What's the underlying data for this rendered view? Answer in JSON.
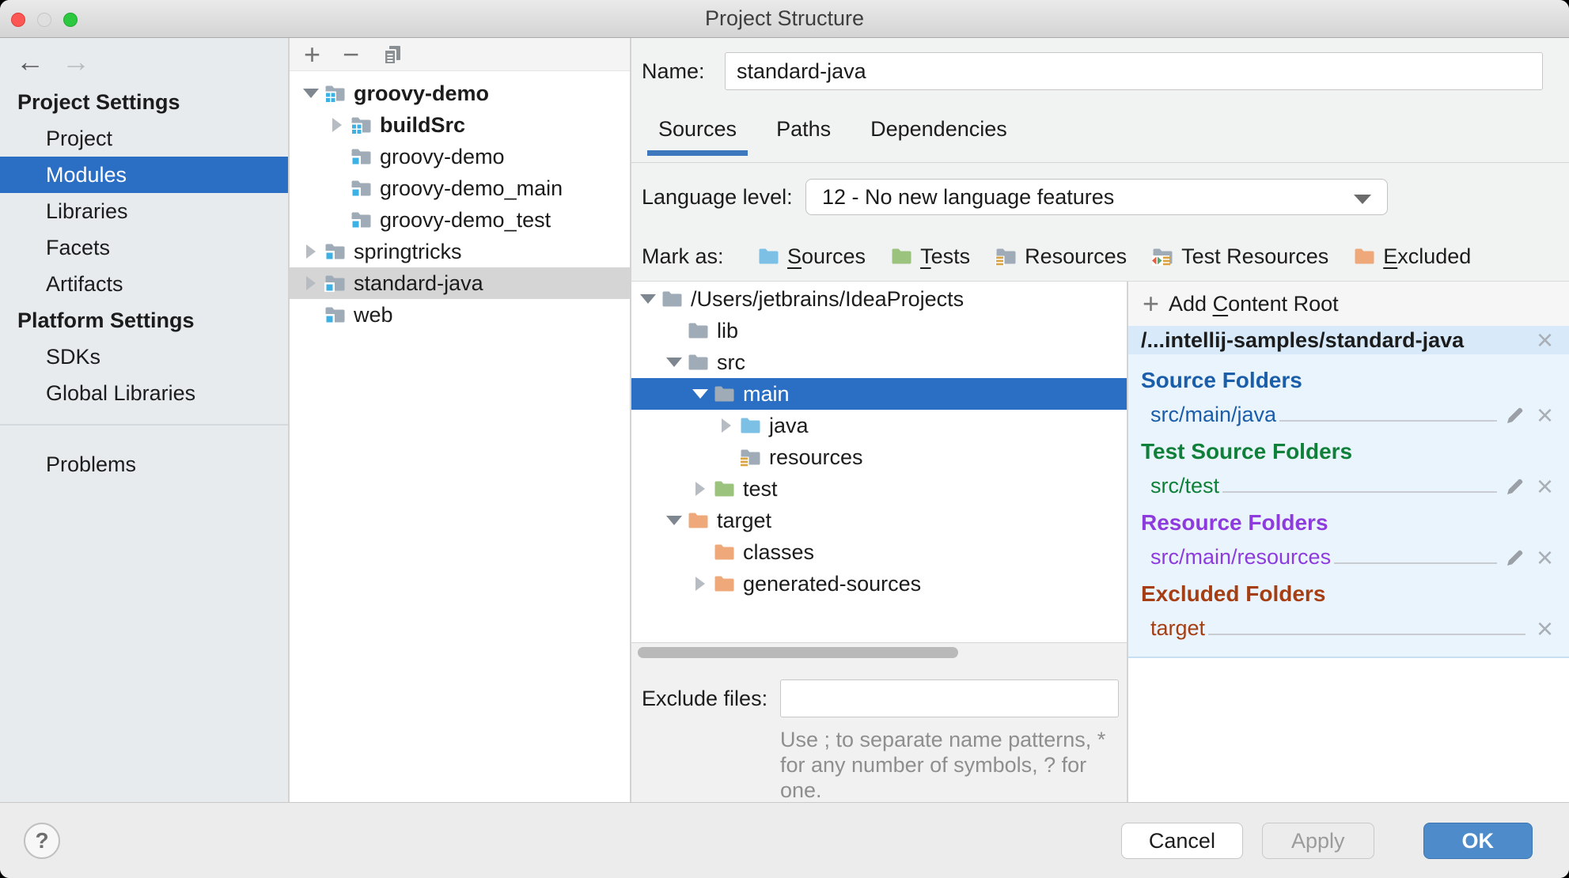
{
  "window": {
    "title": "Project Structure"
  },
  "sidebar": {
    "back": "←",
    "forward": "→",
    "items": [
      {
        "label": "Project Settings",
        "classes": [
          "header"
        ]
      },
      {
        "label": "Project",
        "classes": []
      },
      {
        "label": "Modules",
        "classes": [
          "selected"
        ]
      },
      {
        "label": "Libraries",
        "classes": []
      },
      {
        "label": "Facets",
        "classes": []
      },
      {
        "label": "Artifacts",
        "classes": []
      },
      {
        "label": "Platform Settings",
        "classes": [
          "header"
        ]
      },
      {
        "label": "SDKs",
        "classes": []
      },
      {
        "label": "Global Libraries",
        "classes": []
      },
      {
        "label": "",
        "classes": [
          "divider"
        ]
      },
      {
        "label": "Problems",
        "classes": []
      }
    ]
  },
  "modulesPanel": {
    "toolbar": {
      "add": "+",
      "remove": "−",
      "copy_icon": "copy"
    },
    "tree": [
      {
        "label": "groovy-demo",
        "depth": 0,
        "arrow": "down",
        "icon": "module-project",
        "classes": [
          "bold"
        ]
      },
      {
        "label": "buildSrc",
        "depth": 1,
        "arrow": "right",
        "icon": "module-project",
        "classes": [
          "bold"
        ]
      },
      {
        "label": "groovy-demo",
        "depth": 1,
        "arrow": "none",
        "icon": "module",
        "classes": []
      },
      {
        "label": "groovy-demo_main",
        "depth": 1,
        "arrow": "none",
        "icon": "module",
        "classes": []
      },
      {
        "label": "groovy-demo_test",
        "depth": 1,
        "arrow": "none",
        "icon": "module",
        "classes": []
      },
      {
        "label": "springtricks",
        "depth": 0,
        "arrow": "right",
        "icon": "module",
        "classes": []
      },
      {
        "label": "standard-java",
        "depth": 0,
        "arrow": "right",
        "icon": "module",
        "classes": [
          "selected-inactive"
        ]
      },
      {
        "label": "web",
        "depth": 0,
        "arrow": "none",
        "icon": "module",
        "classes": []
      }
    ]
  },
  "details": {
    "name_label": "Name:",
    "name_value": "standard-java",
    "tabs": [
      {
        "label": "Sources",
        "classes": [
          "active"
        ]
      },
      {
        "label": "Paths",
        "classes": []
      },
      {
        "label": "Dependencies",
        "classes": []
      }
    ],
    "language_level_label": "Language level:",
    "language_level_value": "12 - No new language features",
    "mark_as_label": "Mark as:",
    "mark_as": [
      {
        "pre": "",
        "mn": "S",
        "post": "ources",
        "icon": "folder-blue"
      },
      {
        "pre": "",
        "mn": "T",
        "post": "ests",
        "icon": "folder-green"
      },
      {
        "pre": "Resources",
        "mn": "",
        "post": "",
        "icon": "folder-resources"
      },
      {
        "pre": "Test Resources",
        "mn": "",
        "post": "",
        "icon": "folder-test-resources"
      },
      {
        "pre": "",
        "mn": "E",
        "post": "xcluded",
        "icon": "folder-orange"
      }
    ]
  },
  "fileTree": {
    "rows": [
      {
        "label": "/Users/jetbrains/IdeaProjects",
        "depth": 0,
        "arrow": "down",
        "icon": "folder-gray",
        "classes": []
      },
      {
        "label": "lib",
        "depth": 1,
        "arrow": "none",
        "icon": "folder-gray",
        "classes": []
      },
      {
        "label": "src",
        "depth": 1,
        "arrow": "down",
        "icon": "folder-gray",
        "classes": []
      },
      {
        "label": "main",
        "depth": 2,
        "arrow": "down",
        "icon": "folder-gray",
        "classes": [
          "selected"
        ]
      },
      {
        "label": "java",
        "depth": 3,
        "arrow": "right",
        "icon": "folder-blue",
        "classes": []
      },
      {
        "label": "resources",
        "depth": 3,
        "arrow": "none",
        "icon": "folder-resources",
        "classes": []
      },
      {
        "label": "test",
        "depth": 2,
        "arrow": "right",
        "icon": "folder-green",
        "classes": []
      },
      {
        "label": "target",
        "depth": 1,
        "arrow": "down",
        "icon": "folder-orange",
        "classes": []
      },
      {
        "label": "classes",
        "depth": 2,
        "arrow": "none",
        "icon": "folder-orange",
        "classes": []
      },
      {
        "label": "generated-sources",
        "depth": 2,
        "arrow": "right",
        "icon": "folder-orange",
        "classes": []
      }
    ]
  },
  "excludeFiles": {
    "label": "Exclude files:",
    "value": "",
    "hint_lines": [
      {
        "text": "Use ; to separate name patterns, *"
      },
      {
        "text": "for any number of symbols, ? for"
      },
      {
        "text": "one."
      }
    ]
  },
  "contentRoots": {
    "add_label": {
      "pre": "Add ",
      "mn": "C",
      "post": "ontent Root"
    },
    "root_path": "/...intellij-samples/standard-java",
    "groups": [
      {
        "heading": "Source Folders",
        "path": "src/main/java",
        "classes": [
          "g-source"
        ]
      },
      {
        "heading": "Test Source Folders",
        "path": "src/test",
        "classes": [
          "g-test"
        ]
      },
      {
        "heading": "Resource Folders",
        "path": "src/main/resources",
        "classes": [
          "g-resource"
        ]
      },
      {
        "heading": "Excluded Folders",
        "path": "target",
        "classes": [
          "g-excluded",
          "no-pencil"
        ]
      }
    ]
  },
  "footer": {
    "help": "?",
    "cancel": "Cancel",
    "apply": "Apply",
    "ok": "OK"
  },
  "colors": {
    "selection_blue": "#2B6FC4",
    "inactive_selection": "#D5D5D5",
    "tab_underline": "#3D77BE",
    "ok_button": "#4D8BCB",
    "source_blue": "#1A5DA9",
    "test_green": "#0F8039",
    "resource_purple": "#8E3BDE",
    "excluded_brown": "#A63E13",
    "folder_gray": "#9FABB6",
    "folder_blue": "#7CC0E5",
    "folder_green": "#9CC37E",
    "folder_orange": "#EFA879",
    "stripe_yellow": "#D9A343",
    "module_square_blue": "#3CB1E6",
    "content_root_header_bg": "#D8EAF9",
    "content_root_body_bg": "#EAF4FD"
  }
}
